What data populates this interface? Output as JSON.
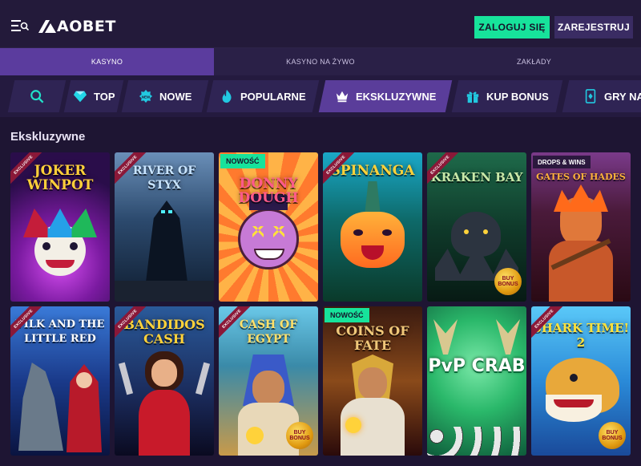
{
  "header": {
    "logo_text": "AOBET",
    "login_label": "ZALOGUJ SIĘ",
    "register_label": "ZAREJESTRUJ"
  },
  "main_nav": {
    "tabs": [
      {
        "label": "KASYNO",
        "active": true
      },
      {
        "label": "KASYNO NA ŻYWO",
        "active": false
      },
      {
        "label": "ZAKŁADY",
        "active": false
      }
    ]
  },
  "categories": [
    {
      "label": "",
      "icon": "search-icon"
    },
    {
      "label": "TOP",
      "icon": "diamond-icon"
    },
    {
      "label": "NOWE",
      "icon": "new-badge-icon"
    },
    {
      "label": "POPULARNE",
      "icon": "flame-icon"
    },
    {
      "label": "EKSKLUZYWNE",
      "icon": "crown-icon",
      "active": true
    },
    {
      "label": "KUP BONUS",
      "icon": "gift-icon"
    },
    {
      "label": "GRY NA",
      "icon": "card-icon"
    }
  ],
  "section_title": "Ekskluzywne",
  "games": [
    {
      "title": "JOKER WINPOT",
      "corner": "EXCLUSIVE",
      "badge": "",
      "buy_bonus": ""
    },
    {
      "title": "RIVER OF STYX",
      "corner": "EXCLUSIVE",
      "badge": "",
      "buy_bonus": ""
    },
    {
      "title": "DONNY DOUGH",
      "corner": "",
      "badge": "NOWOŚĆ",
      "buy_bonus": ""
    },
    {
      "title": "SPINANGA",
      "corner": "EXCLUSIVE",
      "badge": "",
      "buy_bonus": ""
    },
    {
      "title": "KRAKEN BAY",
      "corner": "EXCLUSIVE",
      "badge": "",
      "buy_bonus": "BUY BONUS"
    },
    {
      "title": "GATES OF HADES",
      "corner": "",
      "badge": "DROPS & WINS",
      "buy_bonus": ""
    },
    {
      "title": "VILK AND THE LITTLE RED",
      "corner": "EXCLUSIVE",
      "badge": "",
      "buy_bonus": ""
    },
    {
      "title": "BANDIDOS CASH",
      "corner": "EXCLUSIVE",
      "badge": "",
      "buy_bonus": ""
    },
    {
      "title": "CASH OF EGYPT",
      "corner": "EXCLUSIVE",
      "badge": "",
      "buy_bonus": "BUY BONUS"
    },
    {
      "title": "COINS OF FATE",
      "corner": "",
      "badge": "NOWOŚĆ",
      "buy_bonus": ""
    },
    {
      "title": "PvP CRAB",
      "corner": "",
      "badge": "",
      "buy_bonus": ""
    },
    {
      "title": "SHARK TIME! 2",
      "corner": "EXCLUSIVE",
      "badge": "",
      "buy_bonus": "BUY BONUS"
    }
  ],
  "colors": {
    "accent_green": "#17e39b",
    "accent_purple": "#5a3d9a",
    "background": "#1e1533"
  }
}
